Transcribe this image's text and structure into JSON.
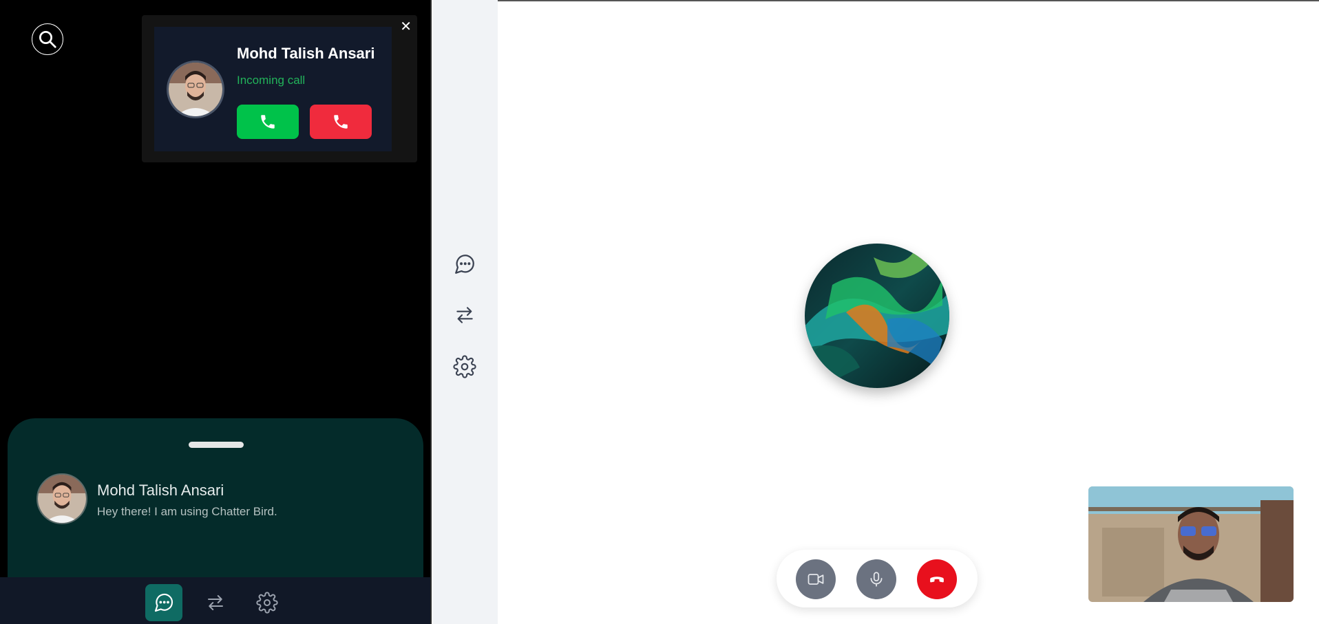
{
  "incoming_call": {
    "caller_name": "Mohd Talish Ansari",
    "status": "Incoming call",
    "close_symbol": "✕",
    "accept_icon": "phone-icon",
    "decline_icon": "phone-hangup-icon"
  },
  "contact": {
    "name": "Mohd Talish Ansari",
    "status": "Hey there! I am using Chatter Bird."
  },
  "bottom_nav": {
    "items": [
      {
        "icon": "chat-icon",
        "active": true
      },
      {
        "icon": "swap-icon",
        "active": false
      },
      {
        "icon": "settings-icon",
        "active": false
      }
    ]
  },
  "sidebar": {
    "items": [
      {
        "icon": "chat-icon"
      },
      {
        "icon": "swap-icon"
      },
      {
        "icon": "settings-icon"
      }
    ]
  },
  "call_controls": {
    "items": [
      {
        "icon": "video-camera-icon"
      },
      {
        "icon": "microphone-icon"
      },
      {
        "icon": "end-call-icon"
      }
    ]
  },
  "colors": {
    "accent_teal": "#0f6b63",
    "accept_green": "#00c24a",
    "decline_red": "#f02b3d",
    "end_call_red": "#e8101d",
    "incoming_status_green": "#22b35a"
  }
}
